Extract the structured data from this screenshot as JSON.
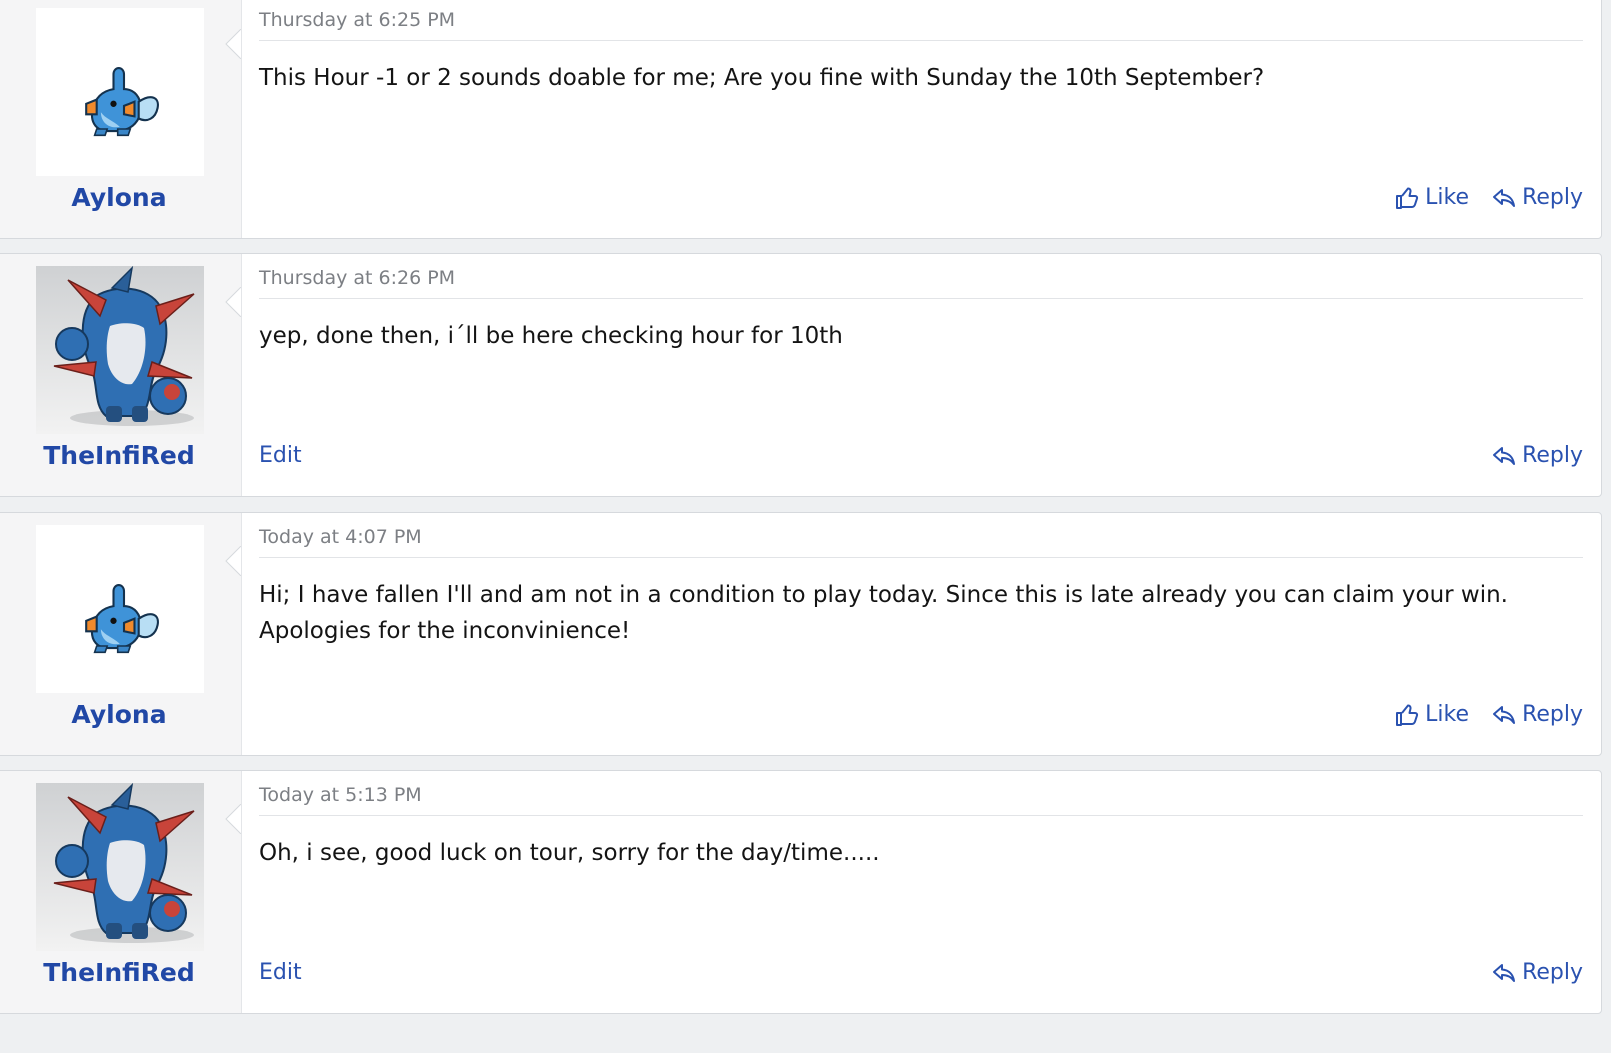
{
  "colors": {
    "username": "#2148a6",
    "action": "#2a52b0",
    "timestamp": "#7c7f84",
    "page_bg": "#eef0f2"
  },
  "labels": {
    "like": "Like",
    "reply": "Reply",
    "edit": "Edit"
  },
  "posts": [
    {
      "username": "Aylona",
      "avatar": "mudkip-sprite",
      "timestamp": "Thursday at 6:25 PM",
      "body": [
        "This Hour -1 or 2 sounds doable for me; Are you fine with Sunday the 10th September?"
      ],
      "actions": [
        "like",
        "reply"
      ]
    },
    {
      "username": "TheInfiRed",
      "avatar": "swampert-figure",
      "timestamp": "Thursday at 6:26 PM",
      "body": [
        "yep, done then, i´ll be here checking hour for 10th"
      ],
      "actions": [
        "edit",
        "reply"
      ]
    },
    {
      "username": "Aylona",
      "avatar": "mudkip-sprite",
      "timestamp": "Today at 4:07 PM",
      "body": [
        "Hi; I have fallen I'll and am not in a condition to play today. Since this is late already you can claim your win.",
        "Apologies for the inconvinience!"
      ],
      "actions": [
        "like",
        "reply"
      ]
    },
    {
      "username": "TheInfiRed",
      "avatar": "swampert-figure",
      "timestamp": "Today at 5:13 PM",
      "body": [
        "Oh, i see, good luck on tour, sorry for the day/time....."
      ],
      "actions": [
        "edit",
        "reply"
      ]
    }
  ]
}
